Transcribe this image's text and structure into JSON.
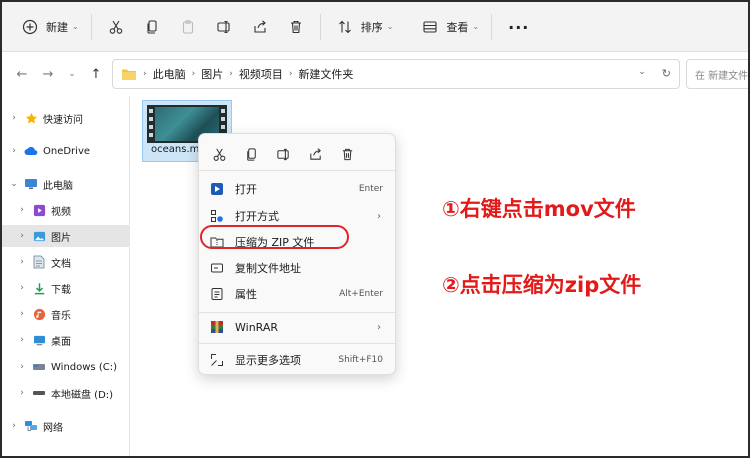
{
  "toolbar": {
    "new_label": "新建",
    "sort_label": "排序",
    "view_label": "查看",
    "more_label": "..."
  },
  "address": {
    "crumbs": [
      "此电脑",
      "图片",
      "视频项目",
      "新建文件夹"
    ],
    "search_placeholder": "在 新建文件夹"
  },
  "sidebar": {
    "items": [
      {
        "label": "快速访问",
        "icon": "star-icon"
      },
      {
        "label": "OneDrive",
        "icon": "cloud-icon"
      },
      {
        "label": "此电脑",
        "icon": "computer-icon"
      },
      {
        "label": "视频",
        "icon": "video-icon"
      },
      {
        "label": "图片",
        "icon": "picture-icon"
      },
      {
        "label": "文档",
        "icon": "document-icon"
      },
      {
        "label": "下载",
        "icon": "download-icon"
      },
      {
        "label": "音乐",
        "icon": "music-icon"
      },
      {
        "label": "桌面",
        "icon": "desktop-icon"
      },
      {
        "label": "Windows (C:)",
        "icon": "drive-c-icon"
      },
      {
        "label": "本地磁盘 (D:)",
        "icon": "drive-d-icon"
      },
      {
        "label": "网络",
        "icon": "network-icon"
      }
    ]
  },
  "file": {
    "name": "oceans.m"
  },
  "context_menu": {
    "items": [
      {
        "label": "打开",
        "shortcut": "Enter"
      },
      {
        "label": "打开方式",
        "shortcut": ""
      },
      {
        "label": "压缩为 ZIP 文件",
        "shortcut": ""
      },
      {
        "label": "复制文件地址",
        "shortcut": ""
      },
      {
        "label": "属性",
        "shortcut": "Alt+Enter"
      },
      {
        "label": "WinRAR",
        "shortcut": ""
      },
      {
        "label": "显示更多选项",
        "shortcut": "Shift+F10"
      }
    ]
  },
  "annotations": {
    "step1": "①右键点击mov文件",
    "step2": "②点击压缩为zip文件"
  },
  "colors": {
    "accent": "#e21a1a",
    "selection": "#cde6f7"
  }
}
